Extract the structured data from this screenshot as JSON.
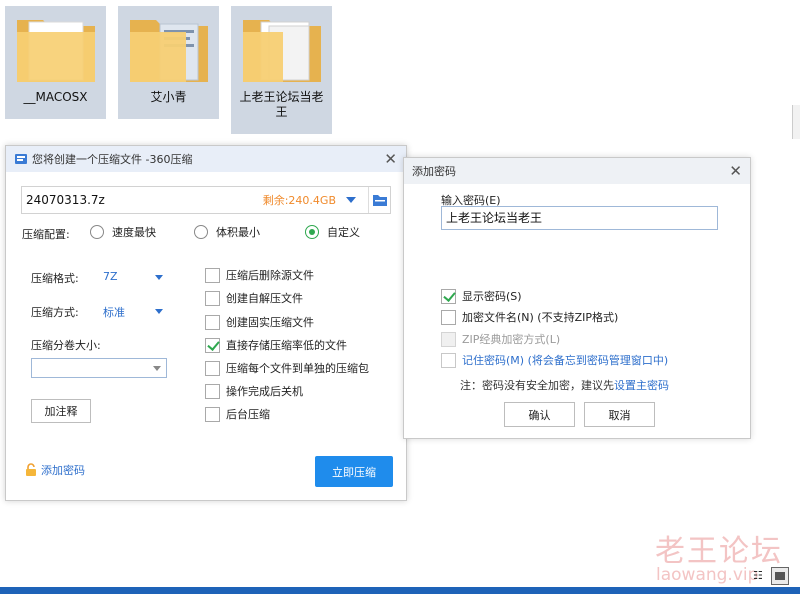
{
  "desktop": {
    "folders": [
      {
        "name": "__MACOSX"
      },
      {
        "name": "艾小青"
      },
      {
        "name": "上老王论坛当老王"
      }
    ],
    "edge_text": "🔒\n?"
  },
  "main_dialog": {
    "title": "您将创建一个压缩文件 -360压缩",
    "path_value": "24070313.7z",
    "free_space": "剩余:240.4GB",
    "config_label": "压缩配置:",
    "radio_options": [
      {
        "label": "速度最快",
        "selected": false
      },
      {
        "label": "体积最小",
        "selected": false
      },
      {
        "label": "自定义",
        "selected": true
      }
    ],
    "format_label": "压缩格式:",
    "format_value": "7Z",
    "method_label": "压缩方式:",
    "method_value": "标准",
    "split_label": "压缩分卷大小:",
    "split_value": "",
    "comment_button": "加注释",
    "options": [
      {
        "label": "压缩后删除源文件",
        "checked": false
      },
      {
        "label": "创建自解压文件",
        "checked": false
      },
      {
        "label": "创建固实压缩文件",
        "checked": false
      },
      {
        "label": "直接存储压缩率低的文件",
        "checked": true
      },
      {
        "label": "压缩每个文件到单独的压缩包",
        "checked": false
      },
      {
        "label": "操作完成后关机",
        "checked": false
      },
      {
        "label": "后台压缩",
        "checked": false
      }
    ],
    "add_password_link": "添加密码",
    "compress_button": "立即压缩"
  },
  "password_dialog": {
    "title": "添加密码",
    "input_label": "输入密码(E)",
    "password_value": "上老王论坛当老王",
    "show_password": {
      "label": "显示密码(S)",
      "checked": true
    },
    "encrypt_filenames": {
      "label": "加密文件名(N) (不支持ZIP格式)",
      "checked": false
    },
    "zip_classic": {
      "label": "ZIP经典加密方式(L)",
      "checked": false,
      "disabled": true
    },
    "remember_password": {
      "label": "记住密码(M) (将会备忘到密码管理窗口中)",
      "checked": false
    },
    "note_prefix": "注：密码没有安全加密，建议先",
    "note_link": "设置主密码",
    "ok_button": "确认",
    "cancel_button": "取消"
  },
  "watermark": {
    "cn": "老王论坛",
    "en": "laowang.vip"
  },
  "colors": {
    "accent_blue": "#1f8cec",
    "link_blue": "#2e6fcc",
    "check_green": "#2fa84f",
    "free_orange": "#f08a2b",
    "folder_yellow": "#f5c96a"
  }
}
